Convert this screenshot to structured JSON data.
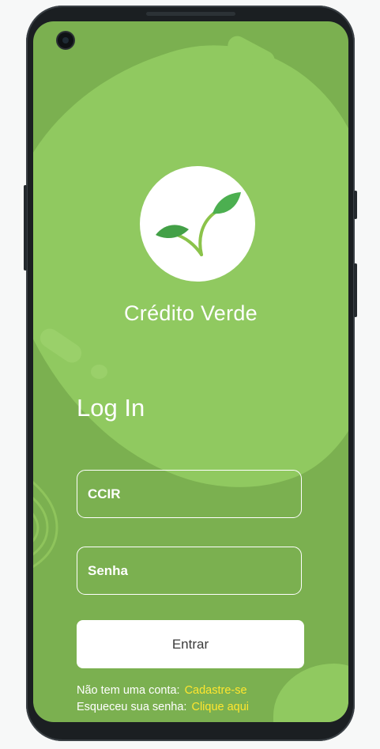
{
  "app": {
    "name": "Crédito Verde"
  },
  "login": {
    "title": "Log In",
    "ccir_placeholder": "CCIR",
    "senha_placeholder": "Senha",
    "submit_label": "Entrar"
  },
  "footer": {
    "signup_prompt": "Não tem uma conta:",
    "signup_link": "Cadastre-se",
    "forgot_prompt": "Esqueceu sua senha:",
    "forgot_link": "Clique aqui"
  },
  "colors": {
    "background": "#7bb050",
    "blob": "#90c960",
    "link": "#ffe62e",
    "leaf": "#4caf50"
  },
  "icons": {
    "logo": "sprout-icon",
    "camera": "front-camera-icon"
  }
}
